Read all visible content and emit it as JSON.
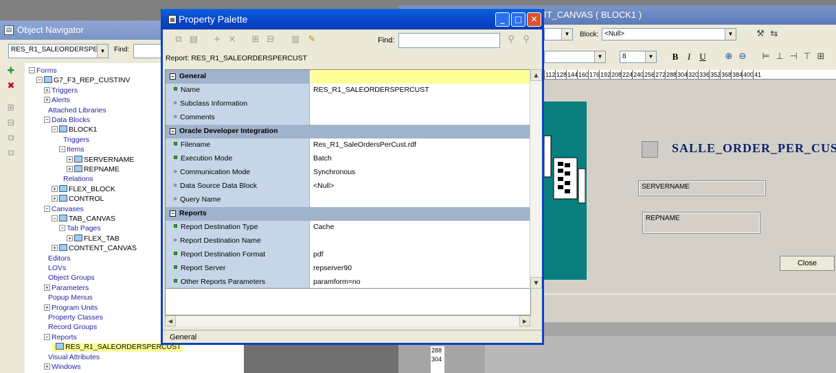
{
  "layout_editor": {
    "title": "IT_CANVAS ( BLOCK1 )",
    "block_label": "Block:",
    "block_value": "<Null>",
    "font_size": "8",
    "format_buttons": [
      "B",
      "I",
      "U"
    ],
    "ruler_ticks": [
      "112",
      "128",
      "144",
      "160",
      "176",
      "192",
      "208",
      "224",
      "240",
      "256",
      "272",
      "288",
      "304",
      "320",
      "336",
      "352",
      "368",
      "384",
      "400",
      "41"
    ],
    "vruler_ticks": [
      "288",
      "304"
    ],
    "canvas_title": "SALLE_ORDER_PER_CUS",
    "field_servername": "SERVERNAME",
    "field_repname": "REPNAME",
    "close_button": "Close"
  },
  "navigator": {
    "title": "Object Navigator",
    "module_combo": "RES_R1_SALEORDERSPE",
    "find_label": "Find:",
    "tree": [
      {
        "label": "Forms",
        "tog": "−"
      },
      {
        "label": "G7_F3_REP_CUSTINV",
        "tog": "−"
      },
      {
        "label": "Triggers",
        "tog": "+"
      },
      {
        "label": "Alerts",
        "tog": "+"
      },
      {
        "label": "Attached Libraries",
        "tog": ""
      },
      {
        "label": "Data Blocks",
        "tog": "−"
      },
      {
        "label": "BLOCK1",
        "tog": "−"
      },
      {
        "label": "Triggers",
        "tog": ""
      },
      {
        "label": "Items",
        "tog": "−"
      },
      {
        "label": "SERVERNAME",
        "tog": "+"
      },
      {
        "label": "REPNAME",
        "tog": "+"
      },
      {
        "label": "Relations",
        "tog": ""
      },
      {
        "label": "FLEX_BLOCK",
        "tog": "+"
      },
      {
        "label": "CONTROL",
        "tog": "+"
      },
      {
        "label": "Canvases",
        "tog": "−"
      },
      {
        "label": "TAB_CANVAS",
        "tog": "−"
      },
      {
        "label": "Tab Pages",
        "tog": "−"
      },
      {
        "label": "FLEX_TAB",
        "tog": "+"
      },
      {
        "label": "CONTENT_CANVAS",
        "tog": "+"
      },
      {
        "label": "Editors",
        "tog": ""
      },
      {
        "label": "LOVs",
        "tog": ""
      },
      {
        "label": "Object Groups",
        "tog": ""
      },
      {
        "label": "Parameters",
        "tog": "+"
      },
      {
        "label": "Popup Menus",
        "tog": ""
      },
      {
        "label": "Program Units",
        "tog": "+"
      },
      {
        "label": "Property Classes",
        "tog": ""
      },
      {
        "label": "Record Groups",
        "tog": ""
      },
      {
        "label": "Reports",
        "tog": "−"
      },
      {
        "label": "RES_R1_SALEORDERSPERCUST",
        "tog": ""
      },
      {
        "label": "Visual Attributes",
        "tog": ""
      },
      {
        "label": "Windows",
        "tog": "+"
      }
    ]
  },
  "palette": {
    "title": "Property Palette",
    "find_label": "Find:",
    "report_label": "Report: RES_R1_SALEORDERSPERCUST",
    "status": "General",
    "rows": [
      {
        "type": "group",
        "name": "General"
      },
      {
        "type": "prop",
        "name": "Name",
        "value": "RES_R1_SALEORDERSPERCUST",
        "set": true
      },
      {
        "type": "prop",
        "name": "Subclass Information",
        "value": "",
        "set": false
      },
      {
        "type": "prop",
        "name": "Comments",
        "value": "",
        "set": false
      },
      {
        "type": "group",
        "name": "Oracle Developer Integration"
      },
      {
        "type": "prop",
        "name": "Filename",
        "value": "Res_R1_SaleOrdersPerCust.rdf",
        "set": true
      },
      {
        "type": "prop",
        "name": "Execution Mode",
        "value": "Batch",
        "set": true
      },
      {
        "type": "prop",
        "name": "Communication Mode",
        "value": "Synchronous",
        "set": false
      },
      {
        "type": "prop",
        "name": "Data Source Data Block",
        "value": "<Null>",
        "set": false
      },
      {
        "type": "prop",
        "name": "Query Name",
        "value": "",
        "set": false
      },
      {
        "type": "group",
        "name": "Reports"
      },
      {
        "type": "prop",
        "name": "Report Destination Type",
        "value": "Cache",
        "set": true
      },
      {
        "type": "prop",
        "name": "Report Destination Name",
        "value": "",
        "set": false
      },
      {
        "type": "prop",
        "name": "Report Destination Format",
        "value": "pdf",
        "set": true
      },
      {
        "type": "prop",
        "name": "Report Server",
        "value": "repserver90",
        "set": true
      },
      {
        "type": "prop",
        "name": "Other Reports Parameters",
        "value": "paramform=no",
        "set": true
      }
    ]
  }
}
